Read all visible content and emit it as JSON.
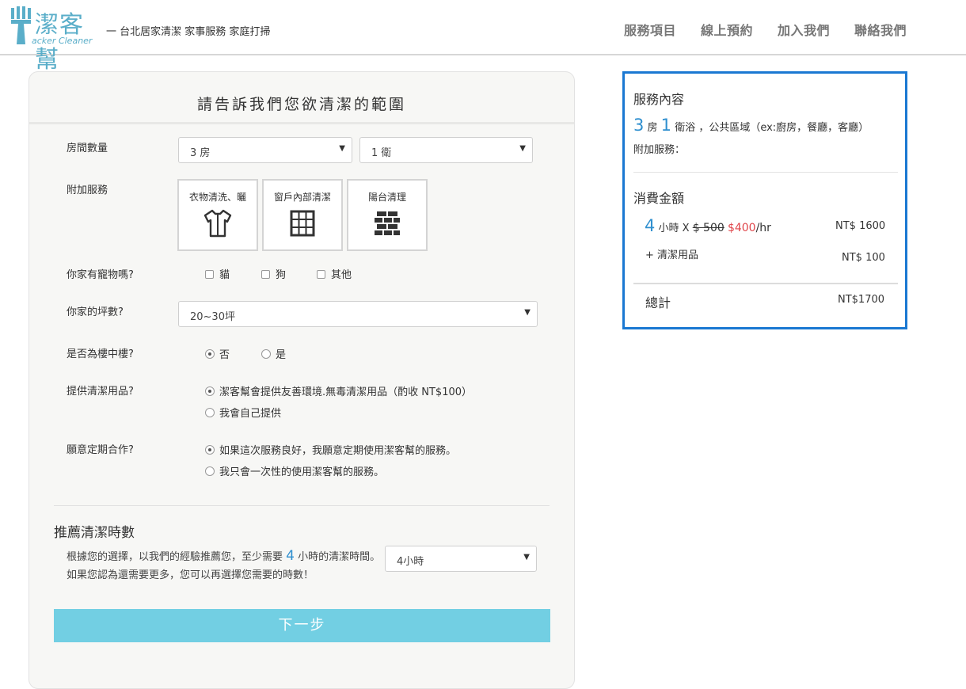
{
  "header": {
    "logo_cn": "潔客幫",
    "logo_en": "acker Cleaner",
    "tagline": "一 台北居家清潔 家事服務 家庭打掃",
    "nav": [
      "服務項目",
      "線上預約",
      "加入我們",
      "聯絡我們"
    ]
  },
  "form": {
    "title": "請告訴我們您欲清潔的範圍",
    "rooms_label": "房間數量",
    "rooms_value": "3 房",
    "baths_value": "1 衛",
    "addon_label": "附加服務",
    "addons": [
      "衣物清洗、曬",
      "窗戶內部清潔",
      "陽台清理"
    ],
    "pets_label": "你家有寵物嗎?",
    "pets": [
      "貓",
      "狗",
      "其他"
    ],
    "size_label": "你家的坪數?",
    "size_value": "20~30坪",
    "mezz_label": "是否為樓中樓?",
    "mezz_options": [
      "否",
      "是"
    ],
    "supplies_label": "提供清潔用品?",
    "supplies_options": [
      "潔客幫會提供友善環境.無毒清潔用品（酌收 NT$100）",
      "我會自己提供"
    ],
    "regular_label": "願意定期合作?",
    "regular_options": [
      "如果這次服務良好，我願意定期使用潔客幫的服務。",
      "我只會一次性的使用潔客幫的服務。"
    ],
    "rec_title": "推薦清潔時數",
    "rec_text_a": "根據您的選擇，以我們的經驗推薦您，至少需要",
    "rec_hours": "4",
    "rec_text_b": "小時的清潔時間。如果您認為還需要更多，您可以再選擇您需要的時數！",
    "hours_value": "4小時",
    "next_label": "下一步"
  },
  "summary": {
    "content_title": "服務內容",
    "rooms_num": "3",
    "rooms_unit": "房",
    "baths_num": "1",
    "baths_unit": "衛浴",
    "areas": "，公共區域（ex:廚房，餐廳，客廳）",
    "addon_line": "附加服務：",
    "cost_title": "消費金額",
    "hours_num": "4",
    "hours_unit": "小時 X",
    "old_price": "$ 500",
    "new_price": "$400",
    "per_hr": "/hr",
    "subtotal": "NT$ 1600",
    "supplies_line": "+ 清潔用品",
    "supplies_price": "NT$ 100",
    "total_label": "總計",
    "total_price": "NT$1700"
  }
}
